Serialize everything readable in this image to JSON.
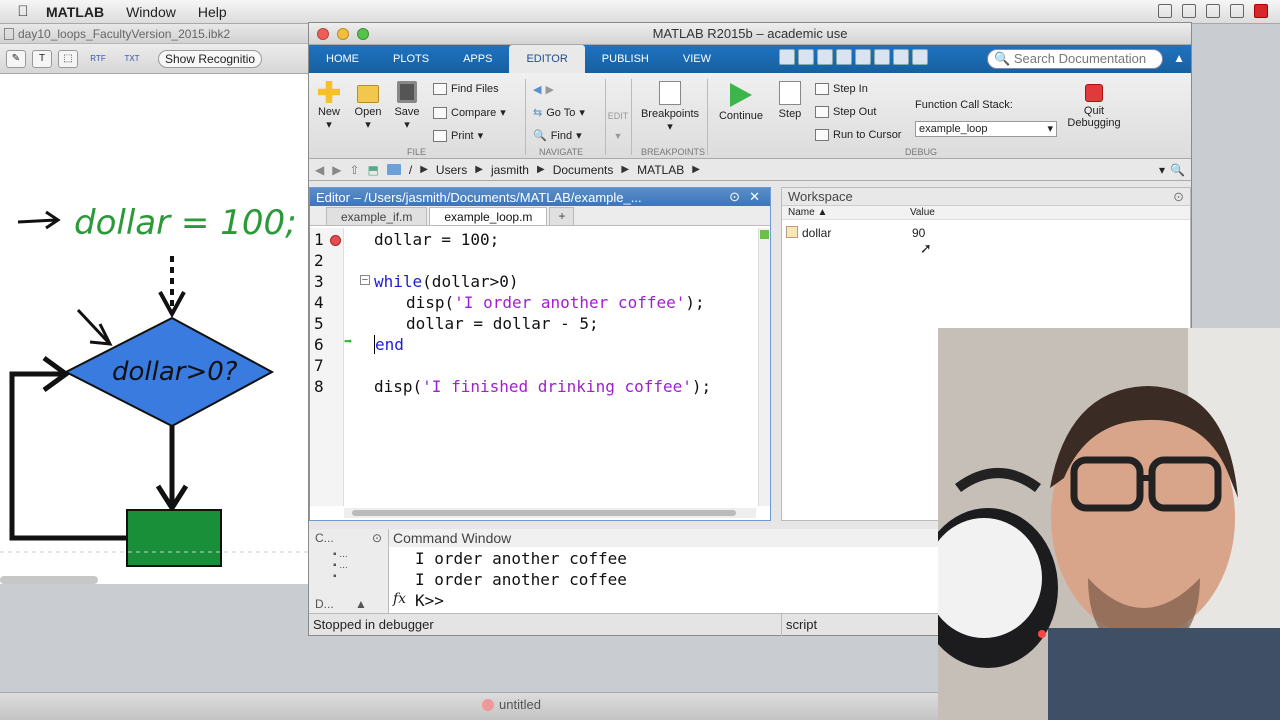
{
  "menubar": {
    "app": "MATLAB",
    "items": [
      "Window",
      "Help"
    ]
  },
  "notebook": {
    "title": "day10_loops_FacultyVersion_2015.ibk2",
    "show_button": "Show Recognitio",
    "rtf": "RTF",
    "txt": "TXT",
    "drawing": {
      "text1": "dollar = 100;",
      "text2": "dollar>0?"
    }
  },
  "matlab": {
    "title": "MATLAB R2015b – academic use",
    "tabs": [
      "HOME",
      "PLOTS",
      "APPS",
      "EDITOR",
      "PUBLISH",
      "VIEW"
    ],
    "active_tab": "EDITOR",
    "search_placeholder": "Search Documentation",
    "ribbon": {
      "new": "New",
      "open": "Open",
      "save": "Save",
      "find_files": "Find Files",
      "compare": "Compare",
      "print": "Print",
      "go_to": "Go To",
      "find": "Find",
      "edit": "EDIT",
      "breakpoints": "Breakpoints",
      "continue": "Continue",
      "step": "Step",
      "step_in": "Step In",
      "step_out": "Step Out",
      "run_to_cursor": "Run to Cursor",
      "function_call_stack": "Function Call Stack:",
      "fcs_value": "example_loop",
      "quit_debugging": "Quit Debugging",
      "groups": {
        "file": "FILE",
        "navigate": "NAVIGATE",
        "breakpoints": "BREAKPOINTS",
        "debug": "DEBUG"
      }
    },
    "path": [
      "/",
      "Users",
      "jasmith",
      "Documents",
      "MATLAB"
    ],
    "editor": {
      "title": "Editor – /Users/jasmith/Documents/MATLAB/example_...",
      "tabs": [
        "example_if.m",
        "example_loop.m"
      ],
      "active_tab": "example_loop.m",
      "line_numbers": [
        "1",
        "2",
        "3",
        "4",
        "5",
        "6",
        "7",
        "8"
      ],
      "lines": {
        "l1": "dollar = 100;",
        "l3_kw": "while",
        "l3_rest": "(dollar>0)",
        "l4_a": "disp(",
        "l4_str": "'I order another coffee'",
        "l4_b": ");",
        "l5": "dollar = dollar - 5;",
        "l6_kw": "end",
        "l8_a": "disp(",
        "l8_str": "'I finished drinking coffee'",
        "l8_b": ");"
      }
    },
    "workspace": {
      "title": "Workspace",
      "col_name": "Name ▲",
      "col_value": "Value",
      "rows": [
        {
          "name": "dollar",
          "value": "90"
        }
      ]
    },
    "command": {
      "title": "Command Window",
      "side_top": "C...",
      "side_bottom": "D...",
      "lines": [
        "I order another coffee",
        "I order another coffee"
      ],
      "prompt": "K>>",
      "fx": "fx"
    },
    "status": {
      "left": "Stopped in debugger",
      "right": "script"
    }
  },
  "dock": {
    "item": "untitled"
  },
  "colors": {
    "ribbon_blue": "#1f73c1",
    "keyword": "#1c1cd9",
    "string": "#a020d0",
    "flow_diamond": "#3a7be0",
    "flow_box": "#1a8f3a",
    "handwriting": "#2a9a38"
  }
}
